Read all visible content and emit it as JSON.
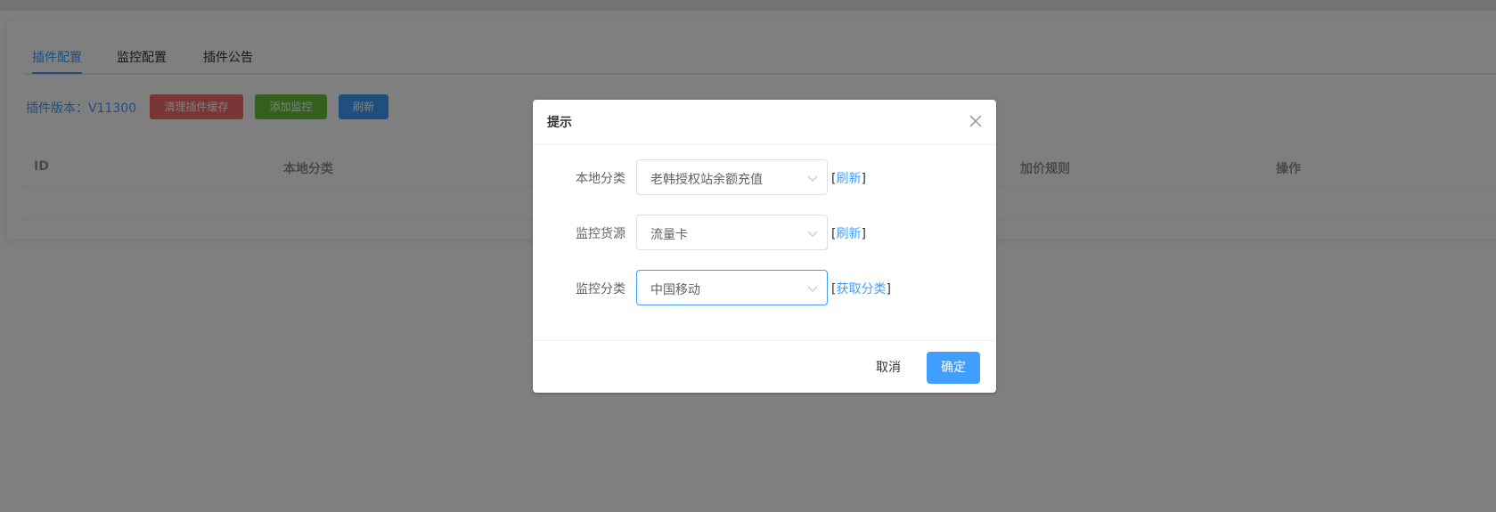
{
  "tabs": [
    {
      "label": "插件配置",
      "active": true
    },
    {
      "label": "监控配置",
      "active": false
    },
    {
      "label": "插件公告",
      "active": false
    }
  ],
  "toolbar": {
    "version": "插件版本：V11300",
    "clear_cache": "清理插件缓存",
    "add_monitor": "添加监控",
    "refresh": "刷新"
  },
  "table": {
    "columns": [
      "ID",
      "本地分类",
      "加价规则",
      "操作"
    ]
  },
  "dialog": {
    "title": "提示",
    "rows": [
      {
        "label": "本地分类",
        "value": "老韩授权站余额充值",
        "link": "刷新"
      },
      {
        "label": "监控货源",
        "value": "流量卡",
        "link": "刷新"
      },
      {
        "label": "监控分类",
        "value": "中国移动",
        "link": "获取分类"
      }
    ],
    "cancel": "取消",
    "confirm": "确定"
  },
  "colors": {
    "primary": "#409eff",
    "danger": "#f56c6c",
    "success": "#67c23a",
    "overlay": "rgba(0,0,0,0.5)"
  }
}
